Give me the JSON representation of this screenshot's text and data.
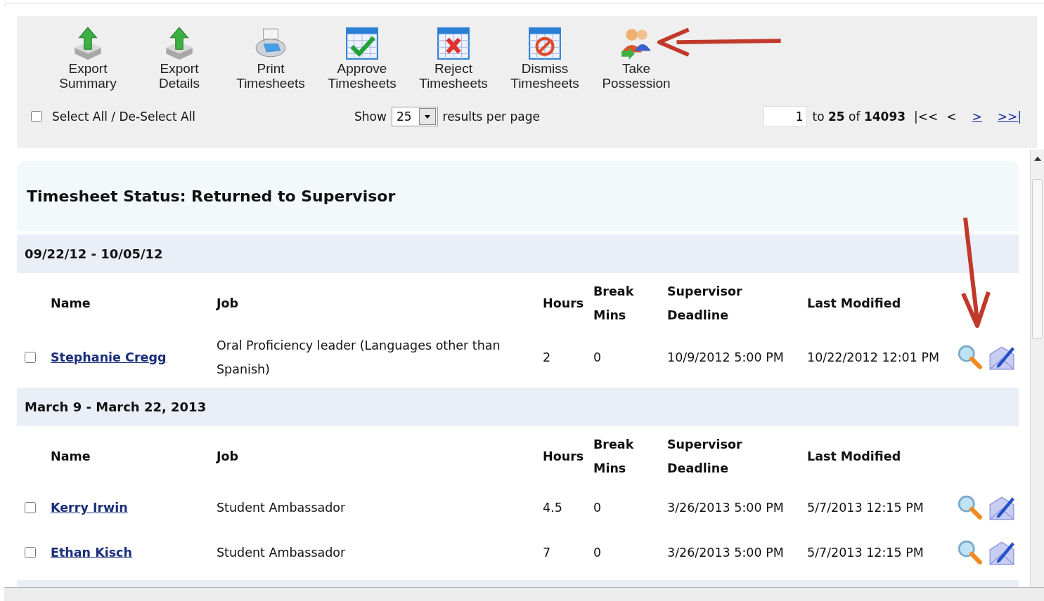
{
  "toolbar": [
    {
      "kind": "export",
      "label": "Export Summary"
    },
    {
      "kind": "export",
      "label": "Export Details"
    },
    {
      "kind": "print",
      "label": "Print Timesheets"
    },
    {
      "kind": "approve",
      "label": "Approve Timesheets"
    },
    {
      "kind": "reject",
      "label": "Reject Timesheets"
    },
    {
      "kind": "dismiss",
      "label": "Dismiss Timesheets"
    },
    {
      "kind": "possession",
      "label": "Take Possession"
    }
  ],
  "select_all": {
    "label": "Select All / De-Select All",
    "checked": false
  },
  "page_size": {
    "before": "Show",
    "value": "25",
    "after": "results per page"
  },
  "pager": {
    "page": "1",
    "summary": "to **25** of **14093**",
    "first": "|<<",
    "prev": "<",
    "next": ">",
    "last": ">>|"
  },
  "status_title": "Timesheet Status: Returned to Supervisor",
  "groups": [
    {
      "period": "09/22/12 - 10/05/12",
      "columns": [
        "Name",
        "Job",
        "Hours",
        "Break Mins",
        "Supervisor Deadline",
        "Last Modified"
      ],
      "rows": [
        {
          "checked": false,
          "name": "Stephanie Cregg",
          "job": "Oral Proficiency leader (Languages other than Spanish)",
          "hours": "2",
          "break": "0",
          "deadline": "10/9/2012 5:00 PM",
          "modified": "10/22/2012 12:01 PM"
        }
      ]
    },
    {
      "period": "March 9 - March 22, 2013",
      "columns": [
        "Name",
        "Job",
        "Hours",
        "Break Mins",
        "Supervisor Deadline",
        "Last Modified"
      ],
      "rows": [
        {
          "checked": false,
          "name": "Kerry Irwin",
          "job": "Student Ambassador",
          "hours": "4.5",
          "break": "0",
          "deadline": "3/26/2013 5:00 PM",
          "modified": "5/7/2013 12:15 PM"
        },
        {
          "checked": false,
          "name": "Ethan Kisch",
          "job": "Student Ambassador",
          "hours": "7",
          "break": "0",
          "deadline": "3/26/2013 5:00 PM",
          "modified": "5/7/2013 12:15 PM"
        }
      ]
    }
  ]
}
